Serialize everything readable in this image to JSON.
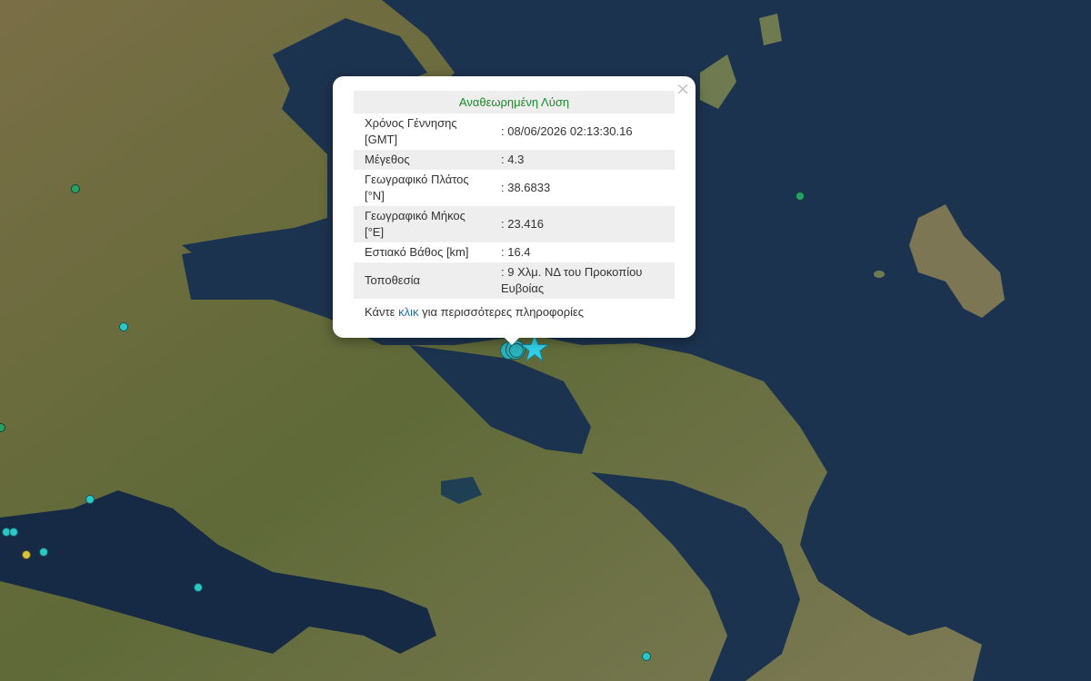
{
  "map": {
    "colors": {
      "sea": "#1c3350",
      "gulf": "#172a45",
      "land": "#6b6a3c",
      "marker_green": "#27a066",
      "marker_cyan": "#2bc6c6",
      "marker_yellow": "#d8c23a",
      "epicenter_star": "#33d1e8"
    },
    "markers": [
      {
        "name": "marker-green",
        "color": "green"
      },
      {
        "name": "marker-green",
        "color": "green"
      },
      {
        "name": "marker-green",
        "color": "green"
      },
      {
        "name": "marker-cyan",
        "color": "cyan"
      },
      {
        "name": "marker-cyan",
        "color": "cyan"
      },
      {
        "name": "marker-cyan",
        "color": "cyan"
      },
      {
        "name": "marker-cyan",
        "color": "cyan"
      },
      {
        "name": "marker-yellow",
        "color": "yellow"
      },
      {
        "name": "marker-cyan",
        "color": "cyan"
      },
      {
        "name": "marker-cyan",
        "color": "cyan"
      },
      {
        "name": "marker-cyan",
        "color": "cyan"
      }
    ],
    "epicenter_icon": "star-icon"
  },
  "popup": {
    "header": "Αναθεωρημένη Λύση",
    "rows": [
      {
        "label": "Χρόνος Γέννησης [GMT]",
        "value": ": 08/06/2026 02:13:30.16"
      },
      {
        "label": "Μέγεθος",
        "value": ": 4.3"
      },
      {
        "label": "Γεωγραφικό Πλάτος [°N]",
        "value": ": 38.6833"
      },
      {
        "label": "Γεωγραφικό Μήκος [°E]",
        "value": ": 23.416"
      },
      {
        "label": "Εστιακό Βάθος [km]",
        "value": ": 16.4"
      },
      {
        "label": "Τοποθεσία",
        "value": ": 9 Χλμ. ΝΔ του Προκοπίου Ευβοίας"
      }
    ],
    "footer_before": "Κάντε ",
    "footer_link": "κλικ",
    "footer_after": " για περισσότερες πληροφορίες",
    "close_symbol": "×"
  }
}
